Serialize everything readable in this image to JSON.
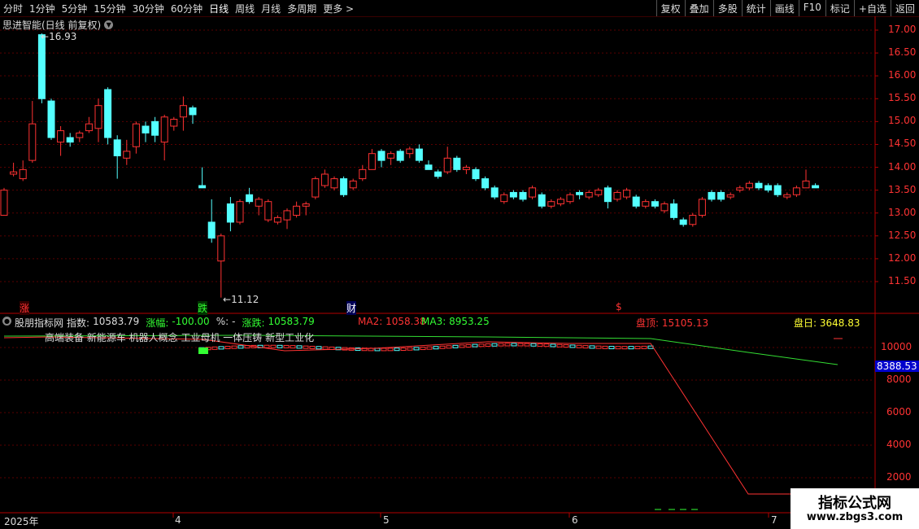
{
  "toolbar": {
    "periods": [
      "分时",
      "1分钟",
      "5分钟",
      "15分钟",
      "30分钟",
      "60分钟",
      "日线",
      "周线",
      "月线",
      "多周期",
      "更多 >"
    ],
    "active_period": "日线",
    "right_buttons": [
      "复权",
      "叠加",
      "多股",
      "统计",
      "画线",
      "F10",
      "标记",
      "+自选",
      "返回"
    ]
  },
  "main_chart": {
    "title": "思进智能(日线 前复权)",
    "high_label": "16.93",
    "low_label": "11.12",
    "price_ticks": [
      "17.00",
      "16.50",
      "16.00",
      "15.50",
      "15.00",
      "14.50",
      "14.00",
      "13.50",
      "13.00",
      "12.50",
      "12.00",
      "11.50"
    ],
    "event_markers": [
      {
        "text": "涨",
        "color": "#ff3333"
      },
      {
        "text": "跌",
        "color": "#33ff33"
      },
      {
        "text": "财",
        "color": "#ffffff"
      },
      {
        "text": "$",
        "color": "#ff3333"
      }
    ],
    "candles": [
      [
        13.5,
        12.95,
        13.2,
        13.55,
        "u"
      ],
      [
        13.9,
        13.85,
        14.1,
        13.8,
        "u"
      ],
      [
        13.95,
        13.75,
        14.15,
        13.7,
        "u"
      ],
      [
        14.95,
        14.15,
        15.45,
        14.1,
        "u"
      ],
      [
        15.5,
        16.9,
        16.93,
        15.4,
        "d"
      ],
      [
        15.45,
        14.65,
        15.5,
        14.6,
        "d"
      ],
      [
        14.8,
        14.55,
        14.9,
        14.25,
        "u"
      ],
      [
        14.65,
        14.55,
        14.75,
        14.45,
        "d"
      ],
      [
        14.75,
        14.65,
        14.8,
        14.55,
        "u"
      ],
      [
        14.95,
        14.8,
        15.1,
        14.75,
        "u"
      ],
      [
        15.35,
        14.85,
        15.5,
        14.55,
        "u"
      ],
      [
        15.7,
        14.65,
        15.75,
        14.5,
        "d"
      ],
      [
        14.6,
        14.25,
        14.7,
        13.75,
        "d"
      ],
      [
        14.35,
        14.2,
        14.6,
        14.05,
        "u"
      ],
      [
        14.95,
        14.45,
        15.0,
        14.3,
        "u"
      ],
      [
        14.9,
        14.75,
        15.0,
        14.55,
        "d"
      ],
      [
        15.0,
        14.7,
        15.1,
        14.55,
        "d"
      ],
      [
        15.1,
        14.55,
        15.15,
        14.15,
        "u"
      ],
      [
        15.05,
        14.9,
        15.1,
        14.8,
        "u"
      ],
      [
        15.35,
        15.1,
        15.55,
        14.8,
        "u"
      ],
      [
        15.3,
        15.15,
        15.35,
        14.95,
        "d"
      ],
      [
        13.6,
        13.55,
        14.0,
        13.55,
        "d"
      ],
      [
        12.45,
        12.8,
        13.3,
        12.35,
        "d"
      ],
      [
        12.5,
        11.95,
        12.55,
        11.15,
        "u"
      ],
      [
        13.2,
        12.8,
        13.35,
        12.6,
        "d"
      ],
      [
        13.25,
        12.8,
        13.3,
        12.75,
        "u"
      ],
      [
        13.4,
        13.25,
        13.55,
        13.2,
        "d"
      ],
      [
        13.3,
        13.15,
        13.35,
        12.95,
        "u"
      ],
      [
        13.25,
        12.85,
        13.3,
        12.8,
        "u"
      ],
      [
        12.9,
        12.8,
        12.95,
        12.75,
        "u"
      ],
      [
        13.05,
        12.85,
        13.1,
        12.65,
        "u"
      ],
      [
        13.15,
        12.95,
        13.25,
        12.9,
        "u"
      ],
      [
        13.2,
        13.15,
        13.25,
        12.95,
        "u"
      ],
      [
        13.75,
        13.35,
        13.8,
        13.3,
        "u"
      ],
      [
        13.85,
        13.6,
        13.95,
        13.55,
        "u"
      ],
      [
        13.75,
        13.55,
        13.8,
        13.5,
        "u"
      ],
      [
        13.75,
        13.4,
        13.8,
        13.35,
        "d"
      ],
      [
        13.7,
        13.55,
        13.75,
        13.5,
        "u"
      ],
      [
        13.95,
        13.75,
        14.05,
        13.7,
        "u"
      ],
      [
        14.3,
        13.95,
        14.4,
        13.95,
        "u"
      ],
      [
        14.35,
        14.15,
        14.4,
        14.0,
        "d"
      ],
      [
        14.3,
        14.2,
        14.35,
        14.05,
        "u"
      ],
      [
        14.35,
        14.15,
        14.4,
        14.1,
        "d"
      ],
      [
        14.4,
        14.3,
        14.45,
        14.2,
        "u"
      ],
      [
        14.4,
        14.15,
        14.5,
        14.1,
        "d"
      ],
      [
        14.05,
        13.95,
        14.15,
        13.95,
        "d"
      ],
      [
        13.9,
        13.8,
        13.95,
        13.75,
        "d"
      ],
      [
        14.2,
        13.9,
        14.45,
        13.85,
        "u"
      ],
      [
        14.2,
        13.95,
        14.25,
        13.9,
        "d"
      ],
      [
        14.0,
        13.95,
        14.05,
        13.85,
        "u"
      ],
      [
        13.95,
        13.75,
        14.0,
        13.7,
        "d"
      ],
      [
        13.75,
        13.55,
        13.8,
        13.5,
        "d"
      ],
      [
        13.55,
        13.35,
        13.6,
        13.3,
        "d"
      ],
      [
        13.4,
        13.25,
        13.45,
        13.2,
        "u"
      ],
      [
        13.45,
        13.35,
        13.5,
        13.3,
        "d"
      ],
      [
        13.45,
        13.3,
        13.5,
        13.25,
        "d"
      ],
      [
        13.55,
        13.35,
        13.6,
        13.3,
        "u"
      ],
      [
        13.4,
        13.15,
        13.45,
        13.1,
        "d"
      ],
      [
        13.25,
        13.15,
        13.3,
        13.1,
        "u"
      ],
      [
        13.3,
        13.2,
        13.35,
        13.15,
        "u"
      ],
      [
        13.4,
        13.25,
        13.45,
        13.2,
        "u"
      ],
      [
        13.45,
        13.4,
        13.5,
        13.3,
        "d"
      ],
      [
        13.45,
        13.35,
        13.5,
        13.3,
        "u"
      ],
      [
        13.5,
        13.4,
        13.55,
        13.35,
        "u"
      ],
      [
        13.55,
        13.25,
        13.6,
        13.1,
        "d"
      ],
      [
        13.45,
        13.3,
        13.5,
        13.25,
        "u"
      ],
      [
        13.5,
        13.35,
        13.55,
        13.3,
        "u"
      ],
      [
        13.35,
        13.15,
        13.4,
        13.1,
        "d"
      ],
      [
        13.25,
        13.15,
        13.3,
        13.1,
        "u"
      ],
      [
        13.25,
        13.15,
        13.3,
        13.1,
        "d"
      ],
      [
        13.2,
        13.05,
        13.25,
        13.0,
        "u"
      ],
      [
        13.2,
        12.9,
        13.3,
        12.85,
        "d"
      ],
      [
        12.85,
        12.75,
        12.9,
        12.7,
        "d"
      ],
      [
        12.95,
        12.75,
        13.0,
        12.7,
        "u"
      ],
      [
        13.3,
        12.95,
        13.35,
        12.9,
        "u"
      ],
      [
        13.45,
        13.3,
        13.5,
        13.25,
        "d"
      ],
      [
        13.45,
        13.3,
        13.5,
        13.25,
        "d"
      ],
      [
        13.4,
        13.35,
        13.45,
        13.3,
        "u"
      ],
      [
        13.55,
        13.5,
        13.6,
        13.45,
        "u"
      ],
      [
        13.65,
        13.55,
        13.7,
        13.5,
        "u"
      ],
      [
        13.65,
        13.55,
        13.7,
        13.5,
        "d"
      ],
      [
        13.6,
        13.5,
        13.65,
        13.45,
        "d"
      ],
      [
        13.6,
        13.4,
        13.65,
        13.35,
        "d"
      ],
      [
        13.4,
        13.35,
        13.45,
        13.3,
        "u"
      ],
      [
        13.55,
        13.4,
        13.6,
        13.35,
        "u"
      ],
      [
        13.7,
        13.55,
        13.95,
        13.55,
        "u"
      ],
      [
        13.6,
        13.55,
        13.65,
        13.55,
        "d"
      ]
    ]
  },
  "indicator": {
    "name": "股朋指标网",
    "index_label": "指数:",
    "index_value": "10583.79",
    "change_pct_label": "涨幅:",
    "change_pct_value": "-100.00",
    "pct_sign": "%:",
    "pct_sign_value": "-",
    "change_label": "涨跌:",
    "change_value": "10583.79",
    "ma2_label": "MA2:",
    "ma2_value": "1058.38",
    "ma3_label": "MA3:",
    "ma3_value": "8953.25",
    "top_label": "盘顶:",
    "top_value": "15105.13",
    "day_label": "盘日:",
    "day_value": "3648.83",
    "concepts": "高端装备 新能源车 机器人概念 工业母机 一体压铸 新型工业化",
    "axis_ticks": [
      "10000",
      "8000",
      "6000",
      "4000",
      "2000"
    ],
    "current_value_tag": "8388.53"
  },
  "date_axis": [
    "2025年",
    "4",
    "5",
    "6",
    "7"
  ],
  "watermark": {
    "line1": "指标公式网",
    "line2": "www.zbgs3.com"
  },
  "colors": {
    "up": "#ff3232",
    "down": "#54ffff",
    "grid": "#5a0000",
    "ma_green": "#33dd33",
    "axis": "#b40000"
  }
}
